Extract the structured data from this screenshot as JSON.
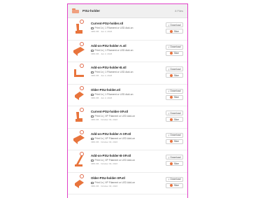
{
  "folder": {
    "name": "PSU-holder",
    "file_count": "8 Files",
    "accent_color": "#e040c8",
    "model_color": "#e8743c"
  },
  "actions": {
    "download_label": "Download",
    "slice_label": "Slice"
  },
  "files": [
    {
      "name": "Current-PSU-holder.stl",
      "desc": "Print 1x | 1 Filament or LED Add-on",
      "date": "3MS KB · Jun 2, 2023",
      "shape": "bracket-upright"
    },
    {
      "name": "Add-on-PSU-holder-A.stl",
      "desc": "Print 1x | 1 Filament or LED Add-on",
      "date": "3MS KB · Jun 2, 2023",
      "shape": "bracket-flat"
    },
    {
      "name": "Add-on-PSU-holder-B.stl",
      "desc": "Print 1x | 1 Filament or LED Add-on",
      "date": "3MS KB · Jun 2, 2023",
      "shape": "bracket-angle"
    },
    {
      "name": "Older-PSU-holder.stl",
      "desc": "Print 1x | 1 Filament or LED Add-on",
      "date": "3MS KB · Jun 2, 2023",
      "shape": "bracket-block"
    },
    {
      "name": "Current-PSU-holder-XP.stl",
      "desc": "Print 1x | XP Filament or LED Add-on",
      "date": "3MS KB · October 30, 2023",
      "shape": "bracket-upright"
    },
    {
      "name": "Add-on-PSU-holder-A-XP.stl",
      "desc": "Print 1x | XP Filament or LED Add-on",
      "date": "3MS KB · October 30, 2023",
      "shape": "bracket-flat"
    },
    {
      "name": "Add-on-PSU-holder-B-XP.stl",
      "desc": "Print 1x | XP Filament or LED Add-on",
      "date": "3MS KB · October 30, 2023",
      "shape": "bracket-tall"
    },
    {
      "name": "Older-PSU-holder-XP.stl",
      "desc": "Print 1x | XP Filament or LED Add-on",
      "date": "3MS KB · October 30, 2023",
      "shape": "bracket-block"
    }
  ]
}
